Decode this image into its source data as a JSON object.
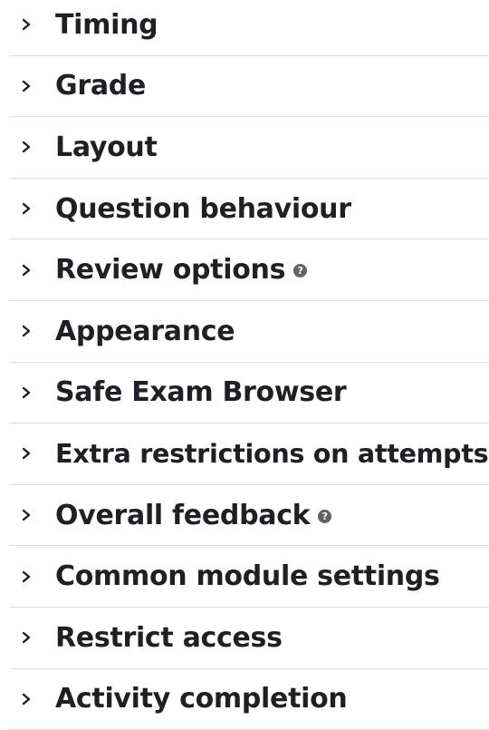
{
  "sections": [
    {
      "label": "Timing",
      "help": false
    },
    {
      "label": "Grade",
      "help": false
    },
    {
      "label": "Layout",
      "help": false
    },
    {
      "label": "Question behaviour",
      "help": false
    },
    {
      "label": "Review options",
      "help": true,
      "help_icon": "question-circle-icon"
    },
    {
      "label": "Appearance",
      "help": false
    },
    {
      "label": "Safe Exam Browser",
      "help": false
    },
    {
      "label": "Extra restrictions on attempts",
      "help": false
    },
    {
      "label": "Overall feedback",
      "help": true,
      "help_icon": "question-circle-icon"
    },
    {
      "label": "Common module settings",
      "help": false
    },
    {
      "label": "Restrict access",
      "help": false
    },
    {
      "label": "Activity completion",
      "help": false
    }
  ],
  "colors": {
    "text": "#1d2125",
    "divider": "#dcdcdc",
    "help_icon_bg": "#5f6368"
  },
  "icons": {
    "expand": "chevron-right-icon",
    "help": "question-circle-icon",
    "help_glyph": "?"
  }
}
